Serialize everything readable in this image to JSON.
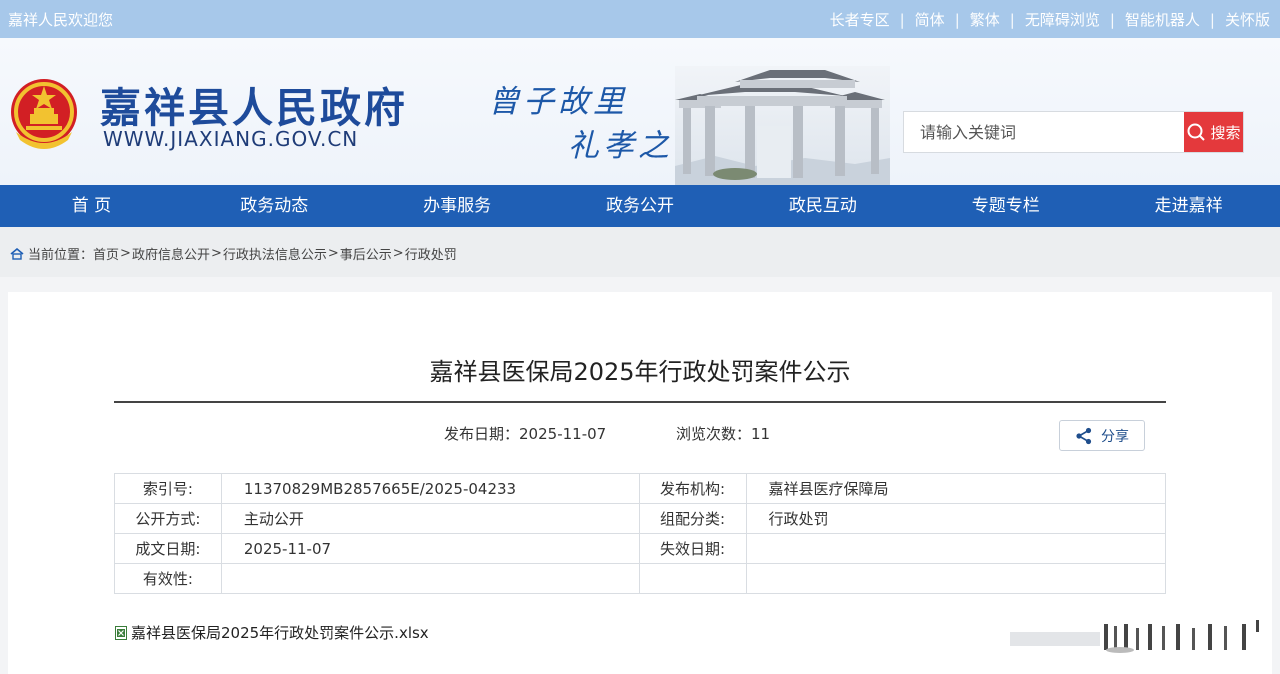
{
  "topbar": {
    "welcome": "嘉祥人民欢迎您",
    "links": [
      "长者专区",
      "简体",
      "繁体",
      "无障碍浏览",
      "智能机器人",
      "关怀版"
    ]
  },
  "header": {
    "site_name": "嘉祥县人民政府",
    "site_url": "WWW.JIAXIANG.GOV.CN",
    "slogan_line1": "曾子故里",
    "slogan_line2": "礼孝之城",
    "search_placeholder": "请输入关键词",
    "search_button": "搜索"
  },
  "nav": {
    "items": [
      "首 页",
      "政务动态",
      "办事服务",
      "政务公开",
      "政民互动",
      "专题专栏",
      "走进嘉祥"
    ]
  },
  "breadcrumb": {
    "prefix": "当前位置：",
    "items": [
      "首页",
      "政府信息公开",
      "行政执法信息公示",
      "事后公示",
      "行政处罚"
    ]
  },
  "article": {
    "title": "嘉祥县医保局2025年行政处罚案件公示",
    "publish_label": "发布日期：",
    "publish_date": "2025-11-07",
    "views_label": "浏览次数：",
    "views": "11",
    "share_label": "分享"
  },
  "info_table": {
    "rows": [
      {
        "l1": "索引号:",
        "v1": "11370829MB2857665E/2025-04233",
        "l2": "发布机构:",
        "v2": "嘉祥县医疗保障局"
      },
      {
        "l1": "公开方式:",
        "v1": "主动公开",
        "l2": "组配分类:",
        "v2": "行政处罚"
      },
      {
        "l1": "成文日期:",
        "v1": "2025-11-07",
        "l2": "失效日期:",
        "v2": ""
      },
      {
        "l1": "有效性:",
        "v1": "",
        "l2": "",
        "v2": ""
      }
    ]
  },
  "attachment": {
    "filename": "嘉祥县医保局2025年行政处罚案件公示.xlsx",
    "icon": "excel-file-icon"
  },
  "colors": {
    "topbar": "#a7c8ea",
    "nav": "#1f5fb5",
    "brand_text": "#1e4b9b",
    "search_button": "#e4393c"
  }
}
